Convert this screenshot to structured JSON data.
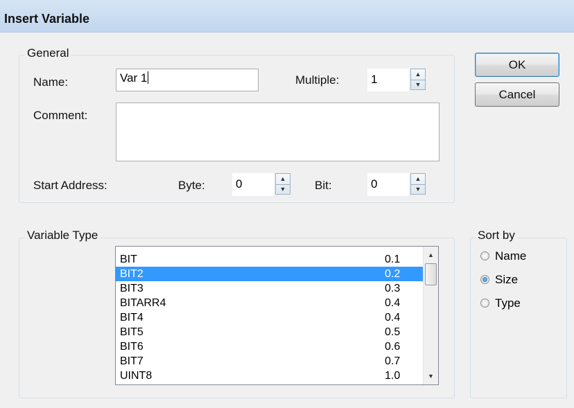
{
  "window": {
    "title": "Insert Variable"
  },
  "general": {
    "group_label": "General",
    "name_label": "Name:",
    "name_value": "Var 1",
    "multiple_label": "Multiple:",
    "multiple_value": "1",
    "comment_label": "Comment:",
    "comment_value": "",
    "start_address_label": "Start Address:",
    "byte_label": "Byte:",
    "byte_value": "0",
    "bit_label": "Bit:",
    "bit_value": "0"
  },
  "buttons": {
    "ok": "OK",
    "cancel": "Cancel"
  },
  "variable_type": {
    "group_label": "Variable Type",
    "items": [
      {
        "name": "BIT",
        "size": "0.1",
        "selected": false
      },
      {
        "name": "BIT2",
        "size": "0.2",
        "selected": true
      },
      {
        "name": "BIT3",
        "size": "0.3",
        "selected": false
      },
      {
        "name": "BITARR4",
        "size": "0.4",
        "selected": false
      },
      {
        "name": "BIT4",
        "size": "0.4",
        "selected": false
      },
      {
        "name": "BIT5",
        "size": "0.5",
        "selected": false
      },
      {
        "name": "BIT6",
        "size": "0.6",
        "selected": false
      },
      {
        "name": "BIT7",
        "size": "0.7",
        "selected": false
      },
      {
        "name": "UINT8",
        "size": "1.0",
        "selected": false
      }
    ]
  },
  "sort_by": {
    "group_label": "Sort by",
    "options": [
      {
        "label": "Name",
        "checked": false
      },
      {
        "label": "Size",
        "checked": true
      },
      {
        "label": "Type",
        "checked": false
      }
    ]
  },
  "colors": {
    "selection": "#3399ff",
    "title_bar": "#c9dcf1"
  }
}
